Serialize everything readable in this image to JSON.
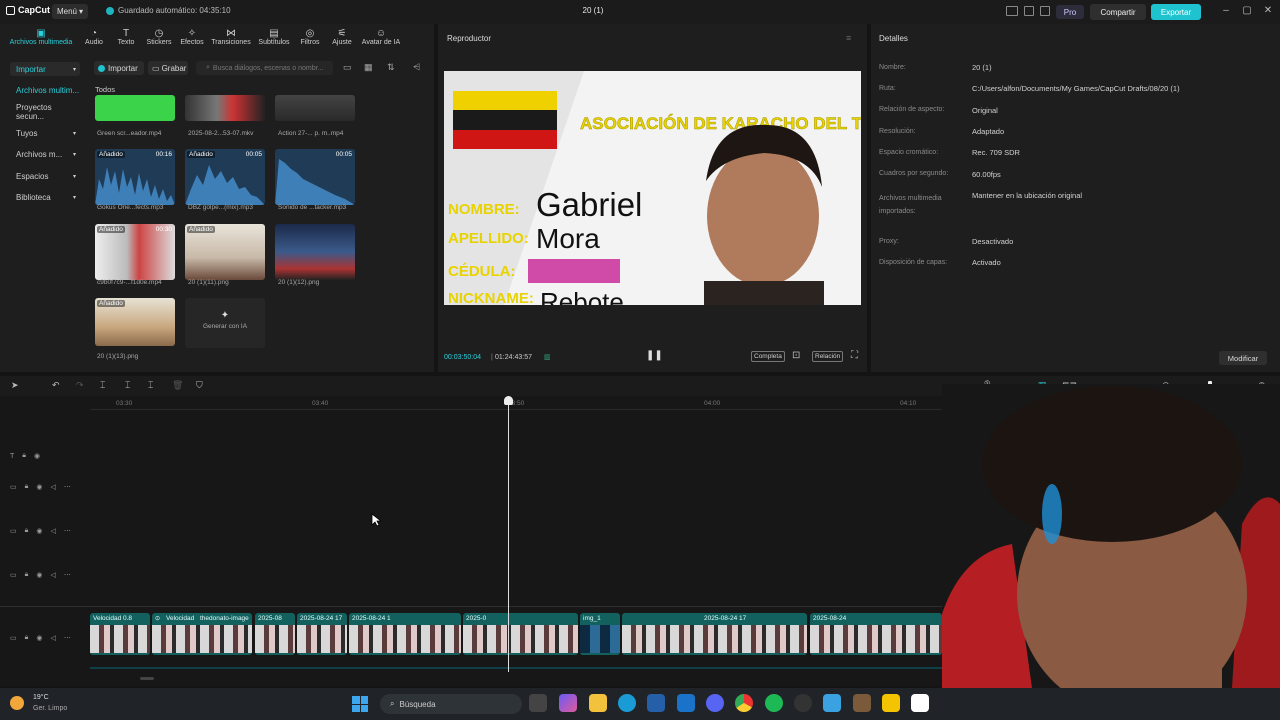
{
  "titlebar": {
    "app_name": "CapCut",
    "menu_label": "Menú",
    "autosave": "Guardado automático: 04:35:10",
    "project_title": "20 (1)",
    "pro_label": "Pro",
    "share_label": "Compartir",
    "export_label": "Exportar"
  },
  "toolbar": {
    "items": [
      "Archivos multimedia",
      "Audio",
      "Texto",
      "Stickers",
      "Efectos",
      "Transiciones",
      "Subtítulos",
      "Filtros",
      "Ajuste",
      "Avatar de IA"
    ]
  },
  "sidebar": {
    "items": [
      "Importar",
      "Archivos multim...",
      "Proyectos secun...",
      "Tuyos",
      "Archivos m...",
      "Espacios",
      "Biblioteca"
    ]
  },
  "media": {
    "import_label": "Importar",
    "record_label": "Grabar",
    "search_placeholder": "Busca diálogos, escenas o nombr...",
    "section": "Todos",
    "added_badge": "Añadido",
    "files": [
      {
        "name": "Green scr...eador.mp4",
        "dur": ""
      },
      {
        "name": "2025-08-2...53-07.mkv",
        "dur": ""
      },
      {
        "name": "Action 27-... p. m..mp4",
        "dur": ""
      },
      {
        "name": "Gokus One...fects.mp3",
        "dur": "00:16"
      },
      {
        "name": "DBZ golpe...(mix).mp3",
        "dur": "00:05"
      },
      {
        "name": "Sonido de ...tacker.mp3",
        "dur": "00:05"
      },
      {
        "name": "c9b0f7c9-...f1d0e.mp4",
        "dur": "00:30"
      },
      {
        "name": "20 (1)(11).png",
        "dur": ""
      },
      {
        "name": "20 (1)(12).png",
        "dur": ""
      },
      {
        "name": "20 (1)(13).png",
        "dur": ""
      }
    ],
    "generate_ai": "Generar con IA"
  },
  "player": {
    "title": "Reproductor",
    "current_time": "00:03:50:04",
    "total_time": "01:24:43:57",
    "full_label": "Completa",
    "ratio_label": "Relación",
    "video": {
      "header": "ASOCIACIÓN DE KARACHO DEL TACHIRA",
      "nombre_lbl": "NOMBRE:",
      "nombre_val": "Gabriel",
      "apellido_lbl": "APELLIDO:",
      "apellido_val": "Mora",
      "cedula_lbl": "CÉDULA:",
      "nickname_lbl": "NICKNAME:",
      "nickname_val": "Rebote"
    }
  },
  "details": {
    "title": "Detalles",
    "rows": [
      {
        "label": "Nombre:",
        "value": "20 (1)"
      },
      {
        "label": "Ruta:",
        "value": "C:/Users/alfon/Documents/My Games/CapCut Drafts/08/20 (1)"
      },
      {
        "label": "Relación de aspecto:",
        "value": "Original"
      },
      {
        "label": "Resolución:",
        "value": "Adaptado"
      },
      {
        "label": "Espacio cromático:",
        "value": "Rec. 709 SDR"
      },
      {
        "label": "Cuadros por segundo:",
        "value": "60.00fps"
      },
      {
        "label": "Archivos multimedia importados:",
        "value": "Mantener en la ubicación original"
      },
      {
        "label": "Proxy:",
        "value": "Desactivado"
      },
      {
        "label": "Disposición de capas:",
        "value": "Activado"
      }
    ],
    "modify_label": "Modificar"
  },
  "timeline": {
    "ticks": [
      "03:30",
      "03:40",
      "03:50",
      "04:00",
      "04:10"
    ],
    "clip_labels": [
      "Velocidad 0.8",
      "Velocidad",
      "thedonato-image",
      "2025-08",
      "2025-08-24 17",
      "2025-08-24 1",
      "2025-0",
      "img_1",
      "2025-08-24 17",
      "2025-08-24"
    ]
  },
  "taskbar": {
    "temp": "19°C",
    "weather": "Ger. Limpo",
    "search_label": "Búsqueda"
  },
  "colors": {
    "accent": "#1fc3cf",
    "clip": "#12615f"
  }
}
